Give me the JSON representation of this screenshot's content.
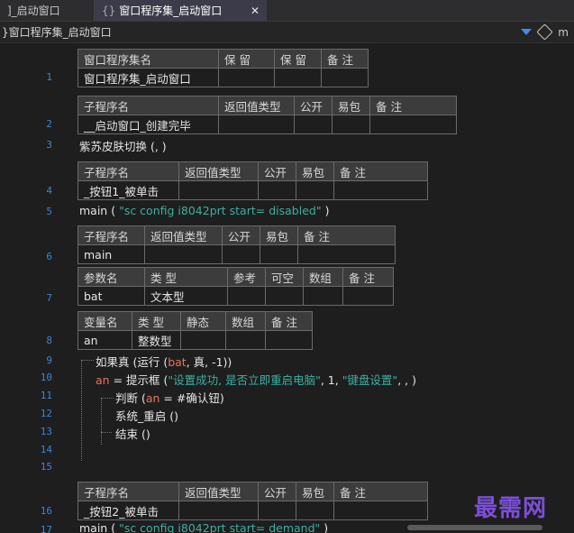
{
  "tabs": [
    {
      "label": "]_启动窗口"
    },
    {
      "icon": "{}",
      "label": "窗口程序集_启动窗口",
      "close": "✕"
    }
  ],
  "pathbar": {
    "label": "}窗口程序集_启动窗口",
    "trunc": "m"
  },
  "line_numbers": [
    "1",
    "2",
    "3",
    "4",
    "5",
    "6",
    "7",
    "8",
    "9",
    "10",
    "11",
    "12",
    "13",
    "14",
    "15",
    "16",
    "17"
  ],
  "assembly_table": {
    "headers": [
      "窗口程序集名",
      "保 留",
      "保 留",
      "备 注"
    ],
    "row": [
      "窗口程序集_启动窗口",
      "",
      "",
      ""
    ]
  },
  "sub1": {
    "headers": [
      "子程序名",
      "返回值类型",
      "公开",
      "易包",
      "备 注"
    ],
    "row": [
      "__启动窗口_创建完毕",
      "",
      "",
      "",
      ""
    ]
  },
  "line3": "紫苏皮肤切换 (, )",
  "sub2": {
    "headers": [
      "子程序名",
      "返回值类型",
      "公开",
      "易包",
      "备 注"
    ],
    "row": [
      "_按钮1_被单击",
      "",
      "",
      "",
      ""
    ]
  },
  "line5": {
    "prefix": "main (",
    "string": "\"sc config i8042prt start= disabled\"",
    "suffix": ")"
  },
  "sub3": {
    "headers": [
      "子程序名",
      "返回值类型",
      "公开",
      "易包",
      "备 注"
    ],
    "row": [
      "main",
      "",
      "",
      "",
      ""
    ]
  },
  "params": {
    "headers": [
      "参数名",
      "类 型",
      "参考",
      "可空",
      "数组",
      "备 注"
    ],
    "row": [
      "bat",
      "文本型",
      "",
      "",
      "",
      ""
    ]
  },
  "vars": {
    "headers": [
      "变量名",
      "类 型",
      "静态",
      "数组",
      "备 注"
    ],
    "row": [
      "an",
      "整数型",
      "",
      "",
      ""
    ]
  },
  "line9": {
    "kw": "如果真 (运行 (",
    "var": "bat",
    "rest": ", 真, -1))"
  },
  "line10": {
    "var": "an",
    "mid": " = 提示框 (",
    "string1": "\"设置成功, 是否立即重启电脑\"",
    "mid2": ", 1, ",
    "string2": "\"键盘设置\"",
    "suffix": ", , )"
  },
  "line11": {
    "kw": "判断 (",
    "var": "an",
    "rest": " = #确认钮)"
  },
  "line12": "系统_重启 ()",
  "line13": "结束 ()",
  "sub4": {
    "headers": [
      "子程序名",
      "返回值类型",
      "公开",
      "易包",
      "备 注"
    ],
    "row": [
      "_按钮2_被单击",
      "",
      "",
      "",
      ""
    ]
  },
  "line17": {
    "prefix": "main (",
    "string": "\"sc config i8042prt start= demand\"",
    "suffix": ")"
  },
  "watermark": "最需网",
  "colors": {
    "line_number": "#3a86d6",
    "string": "#3bb0a0",
    "variable": "#e8735a",
    "accent": "#3b8eea",
    "watermark": "#7b4fd6"
  }
}
